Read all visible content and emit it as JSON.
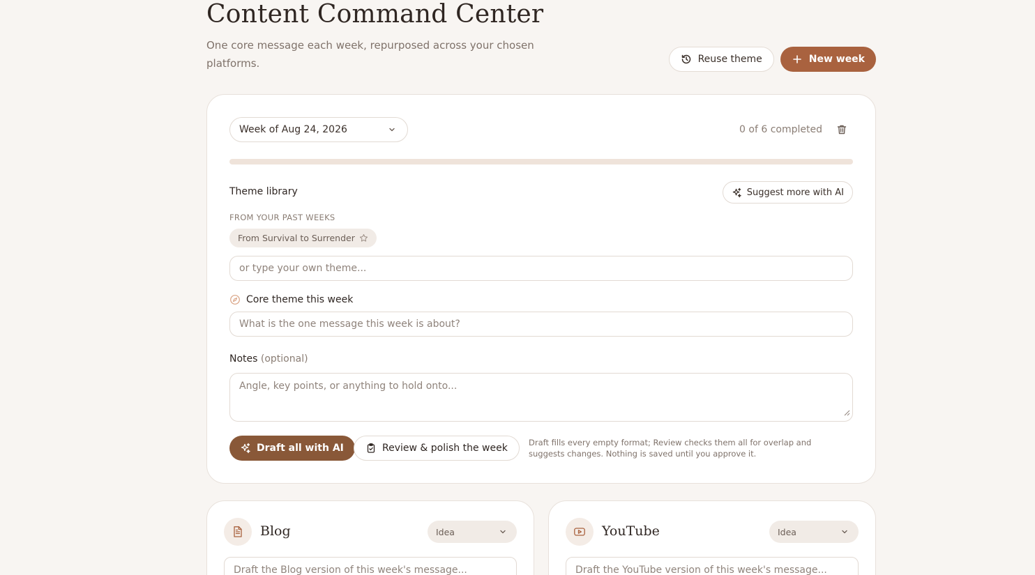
{
  "header": {
    "title": "Content Command Center",
    "subtitle": "One core message each week, repurposed across your chosen platforms.",
    "reuse_label": "Reuse theme",
    "new_week_label": "New week"
  },
  "week_card": {
    "week_selected": "Week of Aug 24, 2026",
    "completed_text": "0 of 6 completed",
    "progress": 0,
    "theme_library_label": "Theme library",
    "suggest_label": "Suggest more with AI",
    "past_weeks_label": "FROM YOUR PAST WEEKS",
    "past_themes": [
      "From Survival to Surrender"
    ],
    "own_theme_placeholder": "or type your own theme...",
    "core_theme_label": "Core theme this week",
    "core_theme_placeholder": "What is the one message this week is about?",
    "notes_label": "Notes",
    "notes_optional": "(optional)",
    "notes_placeholder": "Angle, key points, or anything to hold onto...",
    "draft_label": "Draft all with AI",
    "review_label": "Review & polish the week",
    "hint": "Draft fills every empty format; Review checks them all for overlap and suggests changes. Nothing is saved until you approve it."
  },
  "formats": [
    {
      "name": "Blog",
      "status": "Idea",
      "placeholder": "Draft the Blog version of this week's message...",
      "icon": "document-icon"
    },
    {
      "name": "YouTube",
      "status": "Idea",
      "placeholder": "Draft the YouTube version of this week's message...",
      "icon": "youtube-icon"
    }
  ],
  "colors": {
    "accent": "#a9623f",
    "accent_dark": "#895838",
    "background": "#f8f5f2"
  }
}
